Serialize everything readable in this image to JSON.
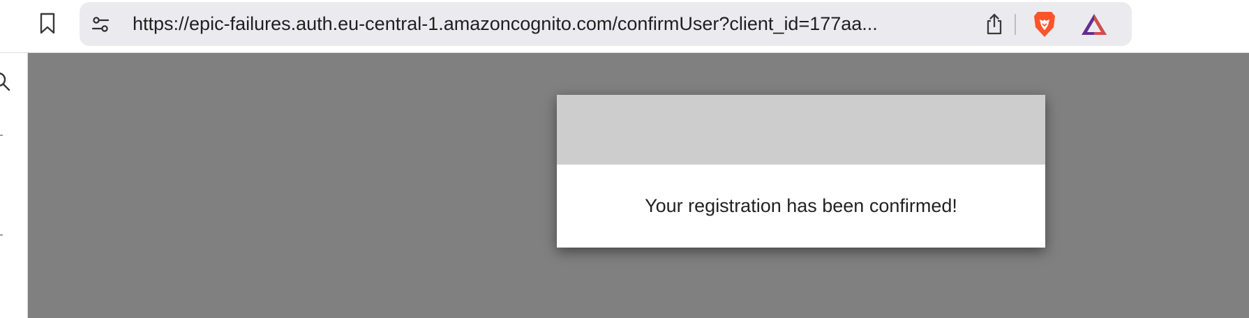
{
  "browser": {
    "url": "https://epic-failures.auth.eu-central-1.amazoncognito.com/confirmUser?client_id=177aa...",
    "icons": {
      "bookmark": "bookmark-icon",
      "site_settings": "site-settings-icon",
      "share": "share-icon",
      "brave_shields": "brave-lion-icon",
      "brave_rewards": "brave-rewards-triangle-icon"
    },
    "colors": {
      "urlbar_bg": "#ebebef",
      "brave_orange": "#fb542b",
      "rewards_purple": "#662d91"
    }
  },
  "sidebar": {
    "icons": [
      "search-icon"
    ]
  },
  "modal": {
    "message": "Your registration has been confirmed!",
    "colors": {
      "header_bg": "#cdcdcd",
      "overlay_bg": "#808080"
    }
  }
}
